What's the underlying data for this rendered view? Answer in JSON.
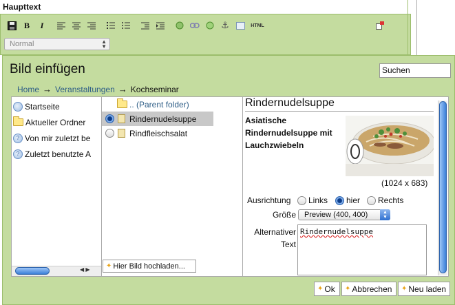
{
  "editor": {
    "label": "Haupttext",
    "format_value": "Normal",
    "toolbar": {
      "save_icon": "floppy-icon",
      "bold": "B",
      "italic": "I",
      "html_label": "HTML"
    }
  },
  "dialog": {
    "title": "Bild einfügen",
    "search_value": "Suchen",
    "breadcrumb": [
      "Home",
      "Veranstaltungen",
      "Kochseminar"
    ],
    "left_nav": [
      {
        "label": "Startseite",
        "icon": "globe-icon"
      },
      {
        "label": "Aktueller Ordner",
        "icon": "folder-icon"
      },
      {
        "label": "Von mir zuletzt be",
        "icon": "question-icon"
      },
      {
        "label": "Zuletzt benutzte A",
        "icon": "question-icon"
      }
    ],
    "files": {
      "parent": ".. (Parent folder)",
      "items": [
        {
          "label": "Rindernudelsuppe",
          "selected": true
        },
        {
          "label": "Rindfleischsalat",
          "selected": false
        }
      ]
    },
    "upload_label": "Hier Bild hochladen...",
    "preview": {
      "title": "Rindernudelsuppe",
      "description": "Asiatische Rindernudelsuppe mit Lauchzwiebeln",
      "dimensions": "(1024 x 683)",
      "align_label": "Ausrichtung",
      "align_options": [
        "Links",
        "hier",
        "Rechts"
      ],
      "align_selected": "hier",
      "size_label": "Größe",
      "size_value": "Preview (400, 400)",
      "alt_label_1": "Alternativer",
      "alt_label_2": "Text",
      "alt_value": "Rindernudelsuppe"
    },
    "buttons": {
      "ok": "Ok",
      "cancel": "Abbrechen",
      "reload": "Neu laden"
    }
  }
}
